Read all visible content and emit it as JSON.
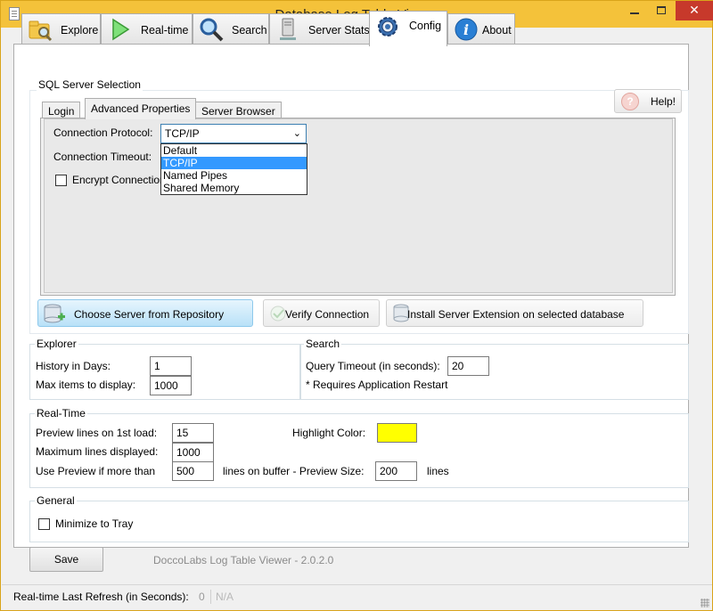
{
  "window": {
    "title": "Database Log Table Viewer",
    "minimize_glyph": "",
    "close_glyph": "✕"
  },
  "main_tabs": [
    {
      "label": "Explore",
      "icon": "folder-search-icon"
    },
    {
      "label": "Real-time",
      "icon": "play-icon"
    },
    {
      "label": "Search",
      "icon": "magnifier-icon"
    },
    {
      "label": "Server Stats",
      "icon": "server-icon"
    },
    {
      "label": "Config",
      "icon": "gear-icon",
      "active": true
    },
    {
      "label": "About",
      "icon": "info-icon"
    }
  ],
  "sql_server": {
    "group_title": "SQL Server Selection",
    "sub_tabs": [
      {
        "label": "Login"
      },
      {
        "label": "Advanced Properties",
        "active": true
      },
      {
        "label": "Server Browser"
      }
    ],
    "help_label": "Help!",
    "help_glyph": "?",
    "connection_protocol_label": "Connection Protocol:",
    "connection_protocol_value": "TCP/IP",
    "connection_protocol_options": [
      "Default",
      "TCP/IP",
      "Named Pipes",
      "Shared Memory"
    ],
    "connection_timeout_label": "Connection Timeout:",
    "encrypt_connection_label": "Encrypt Connection",
    "buttons": {
      "choose_server": "Choose Server from Repository",
      "verify_connection": "Verify Connection",
      "install_extension": "Install Server Extension on selected database"
    }
  },
  "explorer": {
    "group_title": "Explorer",
    "history_days_label": "History in Days:",
    "history_days_value": "1",
    "max_items_label": "Max items to display:",
    "max_items_value": "1000"
  },
  "search": {
    "group_title": "Search",
    "query_timeout_label": "Query Timeout (in seconds):",
    "query_timeout_value": "20",
    "restart_note": "* Requires Application Restart"
  },
  "realtime": {
    "group_title": "Real-Time",
    "preview_lines_label": "Preview lines on 1st load:",
    "preview_lines_value": "15",
    "max_lines_label": "Maximum lines displayed:",
    "max_lines_value": "1000",
    "use_preview_label": "Use Preview if more than",
    "use_preview_value": "500",
    "lines_on_buffer_label": "lines on buffer  - Preview Size:",
    "preview_size_value": "200",
    "lines_label": "lines",
    "highlight_color_label": "Highlight Color:",
    "highlight_color": "#ffff00"
  },
  "general": {
    "group_title": "General",
    "minimize_to_tray_label": "Minimize to Tray"
  },
  "footer": {
    "save_label": "Save",
    "version_text": "DoccoLabs Log Table Viewer - 2.0.2.0"
  },
  "statusbar": {
    "refresh_label": "Real-time Last Refresh (in Seconds):",
    "refresh_value": "0",
    "last_value": "N/A"
  }
}
